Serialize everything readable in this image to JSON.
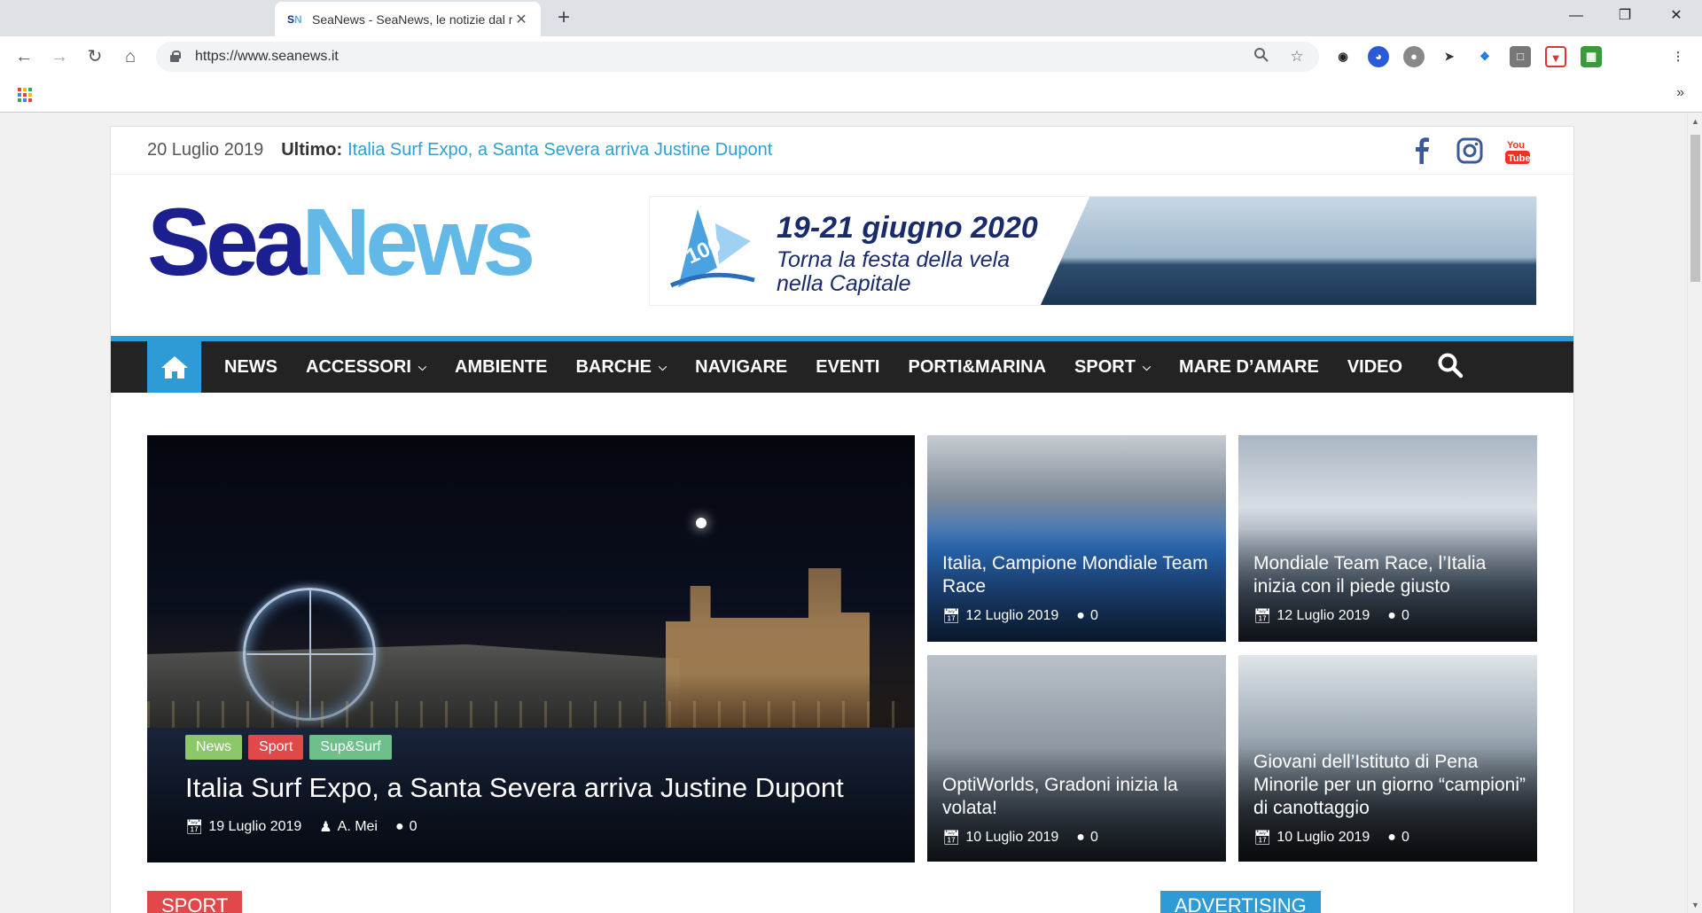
{
  "browser": {
    "tab_favicon": "SN",
    "tab_title": "SeaNews - SeaNews, le notizie dal mare",
    "new_tab": "+",
    "url": "https://www.seanews.it",
    "more_bookmarks": "»"
  },
  "topbar": {
    "date": "20 Luglio 2019",
    "latest_label": "Ultimo:",
    "latest_link": "Italia Surf Expo, a Santa Severa arriva Justine Dupont"
  },
  "logo": {
    "part1": "Sea",
    "part2": "News"
  },
  "banner": {
    "title": "19-21 giugno 2020",
    "line1": "Torna la festa della vela",
    "line2": "nella Capitale"
  },
  "nav": {
    "items": [
      {
        "label": "NEWS",
        "dropdown": false
      },
      {
        "label": "ACCESSORI",
        "dropdown": true
      },
      {
        "label": "AMBIENTE",
        "dropdown": false
      },
      {
        "label": "BARCHE",
        "dropdown": true
      },
      {
        "label": "NAVIGARE",
        "dropdown": false
      },
      {
        "label": "EVENTI",
        "dropdown": false
      },
      {
        "label": "PORTI&MARINA",
        "dropdown": false
      },
      {
        "label": "SPORT",
        "dropdown": true
      },
      {
        "label": "MARE D’AMARE",
        "dropdown": false
      },
      {
        "label": "VIDEO",
        "dropdown": false
      }
    ]
  },
  "featured": {
    "categories": [
      {
        "label": "News",
        "color": "#8cc76a"
      },
      {
        "label": "Sport",
        "color": "#e0484a"
      },
      {
        "label": "Sup&Surf",
        "color": "#6fbf8a"
      }
    ],
    "title": "Italia Surf Expo, a Santa Severa arriva Justine Dupont",
    "date": "19 Luglio 2019",
    "author": "A. Mei",
    "comments": "0"
  },
  "cards": [
    {
      "title": "Italia, Campione Mondiale Team Race",
      "date": "12 Luglio 2019",
      "comments": "0"
    },
    {
      "title": "Mondiale Team Race, l’Italia inizia con il piede giusto",
      "date": "12 Luglio 2019",
      "comments": "0"
    },
    {
      "title": "OptiWorlds, Gradoni inizia la volata!",
      "date": "10 Luglio 2019",
      "comments": "0"
    },
    {
      "title": "Giovani dell’Istituto di Pena Minorile per un giorno “campioni” di canottaggio",
      "date": "10 Luglio 2019",
      "comments": "0"
    }
  ],
  "sections": {
    "left": "SPORT",
    "right": "ADVERTISING"
  },
  "colors": {
    "accent": "#2e9bd6",
    "nav_bg": "#232323",
    "logo_dark": "#1b1f8f",
    "logo_light": "#62b9e8"
  }
}
